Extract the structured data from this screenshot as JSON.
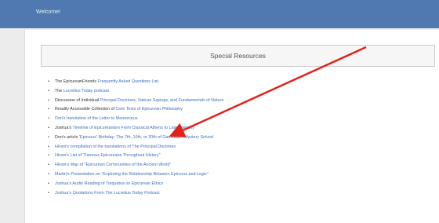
{
  "header": {
    "welcome": "Welcome!"
  },
  "section": {
    "title": "Special Resources"
  },
  "resources": [
    {
      "pre": "The EpicureanFriends ",
      "link": "Frequently Asked Questions List.",
      "post": ""
    },
    {
      "pre": "The ",
      "link": "Lucretius Today podcast.",
      "post": ""
    },
    {
      "pre": "Discussion of Individual ",
      "link": "Principal Doctrines, Vatican Sayings,",
      "post": " and Fundamentals of Nature"
    },
    {
      "pre": "Readily Accessible Collection of ",
      "link": "Core Texts of Epicurean Philosophy",
      "post": ""
    },
    {
      "pre": "",
      "link": "Don's translation of the Letter to Menoeceus",
      "post": ""
    },
    {
      "pre": "Joshua's ",
      "link": "Timeline of Epicureanism From Classical Athens to Late Antiquity",
      "post": ""
    },
    {
      "pre": "Don's article ",
      "link": "'Epicurus' Birthday: The 7th, 10th, or 20th of Gamelion - Mystery Solved",
      "post": ""
    },
    {
      "pre": "",
      "link": "Hiram's compilation of the translations of The Principal Doctrines",
      "post": ""
    },
    {
      "pre": "",
      "link": "Hiram's List of \"Famous Epicureans Throughout History\"",
      "post": ""
    },
    {
      "pre": "",
      "link": "Hiram's Map of \"Epicurean Communities of the Ancient World\"",
      "post": ""
    },
    {
      "pre": "",
      "link": "Martin's Presentation on \"Exploring the Relationship Between Epicurus and Logic\"",
      "post": ""
    },
    {
      "pre": "",
      "link": "Joshua's Audio Reading of Torquatus on Epicurean Ethics",
      "post": ""
    },
    {
      "pre": "",
      "link": "Joshua's Quotations From The Lucretius Today Podcast",
      "post": ""
    }
  ],
  "colors": {
    "topbar": "#4f79b0",
    "link": "#3c6fbf",
    "arrow": "#e0241b"
  }
}
